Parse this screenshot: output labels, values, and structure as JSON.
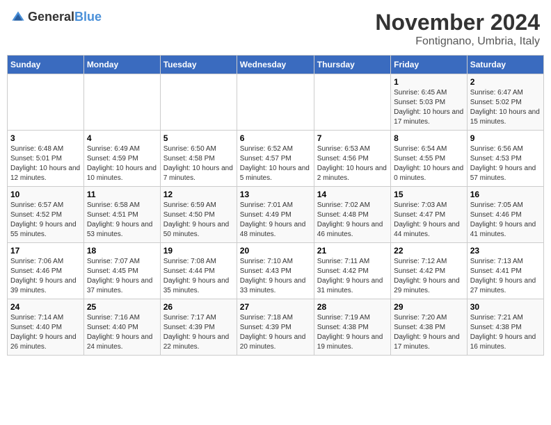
{
  "logo": {
    "text_general": "General",
    "text_blue": "Blue"
  },
  "title": {
    "month": "November 2024",
    "location": "Fontignano, Umbria, Italy"
  },
  "weekdays": [
    "Sunday",
    "Monday",
    "Tuesday",
    "Wednesday",
    "Thursday",
    "Friday",
    "Saturday"
  ],
  "weeks": [
    [
      {
        "day": "",
        "info": ""
      },
      {
        "day": "",
        "info": ""
      },
      {
        "day": "",
        "info": ""
      },
      {
        "day": "",
        "info": ""
      },
      {
        "day": "",
        "info": ""
      },
      {
        "day": "1",
        "info": "Sunrise: 6:45 AM\nSunset: 5:03 PM\nDaylight: 10 hours and 17 minutes."
      },
      {
        "day": "2",
        "info": "Sunrise: 6:47 AM\nSunset: 5:02 PM\nDaylight: 10 hours and 15 minutes."
      }
    ],
    [
      {
        "day": "3",
        "info": "Sunrise: 6:48 AM\nSunset: 5:01 PM\nDaylight: 10 hours and 12 minutes."
      },
      {
        "day": "4",
        "info": "Sunrise: 6:49 AM\nSunset: 4:59 PM\nDaylight: 10 hours and 10 minutes."
      },
      {
        "day": "5",
        "info": "Sunrise: 6:50 AM\nSunset: 4:58 PM\nDaylight: 10 hours and 7 minutes."
      },
      {
        "day": "6",
        "info": "Sunrise: 6:52 AM\nSunset: 4:57 PM\nDaylight: 10 hours and 5 minutes."
      },
      {
        "day": "7",
        "info": "Sunrise: 6:53 AM\nSunset: 4:56 PM\nDaylight: 10 hours and 2 minutes."
      },
      {
        "day": "8",
        "info": "Sunrise: 6:54 AM\nSunset: 4:55 PM\nDaylight: 10 hours and 0 minutes."
      },
      {
        "day": "9",
        "info": "Sunrise: 6:56 AM\nSunset: 4:53 PM\nDaylight: 9 hours and 57 minutes."
      }
    ],
    [
      {
        "day": "10",
        "info": "Sunrise: 6:57 AM\nSunset: 4:52 PM\nDaylight: 9 hours and 55 minutes."
      },
      {
        "day": "11",
        "info": "Sunrise: 6:58 AM\nSunset: 4:51 PM\nDaylight: 9 hours and 53 minutes."
      },
      {
        "day": "12",
        "info": "Sunrise: 6:59 AM\nSunset: 4:50 PM\nDaylight: 9 hours and 50 minutes."
      },
      {
        "day": "13",
        "info": "Sunrise: 7:01 AM\nSunset: 4:49 PM\nDaylight: 9 hours and 48 minutes."
      },
      {
        "day": "14",
        "info": "Sunrise: 7:02 AM\nSunset: 4:48 PM\nDaylight: 9 hours and 46 minutes."
      },
      {
        "day": "15",
        "info": "Sunrise: 7:03 AM\nSunset: 4:47 PM\nDaylight: 9 hours and 44 minutes."
      },
      {
        "day": "16",
        "info": "Sunrise: 7:05 AM\nSunset: 4:46 PM\nDaylight: 9 hours and 41 minutes."
      }
    ],
    [
      {
        "day": "17",
        "info": "Sunrise: 7:06 AM\nSunset: 4:46 PM\nDaylight: 9 hours and 39 minutes."
      },
      {
        "day": "18",
        "info": "Sunrise: 7:07 AM\nSunset: 4:45 PM\nDaylight: 9 hours and 37 minutes."
      },
      {
        "day": "19",
        "info": "Sunrise: 7:08 AM\nSunset: 4:44 PM\nDaylight: 9 hours and 35 minutes."
      },
      {
        "day": "20",
        "info": "Sunrise: 7:10 AM\nSunset: 4:43 PM\nDaylight: 9 hours and 33 minutes."
      },
      {
        "day": "21",
        "info": "Sunrise: 7:11 AM\nSunset: 4:42 PM\nDaylight: 9 hours and 31 minutes."
      },
      {
        "day": "22",
        "info": "Sunrise: 7:12 AM\nSunset: 4:42 PM\nDaylight: 9 hours and 29 minutes."
      },
      {
        "day": "23",
        "info": "Sunrise: 7:13 AM\nSunset: 4:41 PM\nDaylight: 9 hours and 27 minutes."
      }
    ],
    [
      {
        "day": "24",
        "info": "Sunrise: 7:14 AM\nSunset: 4:40 PM\nDaylight: 9 hours and 26 minutes."
      },
      {
        "day": "25",
        "info": "Sunrise: 7:16 AM\nSunset: 4:40 PM\nDaylight: 9 hours and 24 minutes."
      },
      {
        "day": "26",
        "info": "Sunrise: 7:17 AM\nSunset: 4:39 PM\nDaylight: 9 hours and 22 minutes."
      },
      {
        "day": "27",
        "info": "Sunrise: 7:18 AM\nSunset: 4:39 PM\nDaylight: 9 hours and 20 minutes."
      },
      {
        "day": "28",
        "info": "Sunrise: 7:19 AM\nSunset: 4:38 PM\nDaylight: 9 hours and 19 minutes."
      },
      {
        "day": "29",
        "info": "Sunrise: 7:20 AM\nSunset: 4:38 PM\nDaylight: 9 hours and 17 minutes."
      },
      {
        "day": "30",
        "info": "Sunrise: 7:21 AM\nSunset: 4:38 PM\nDaylight: 9 hours and 16 minutes."
      }
    ]
  ]
}
